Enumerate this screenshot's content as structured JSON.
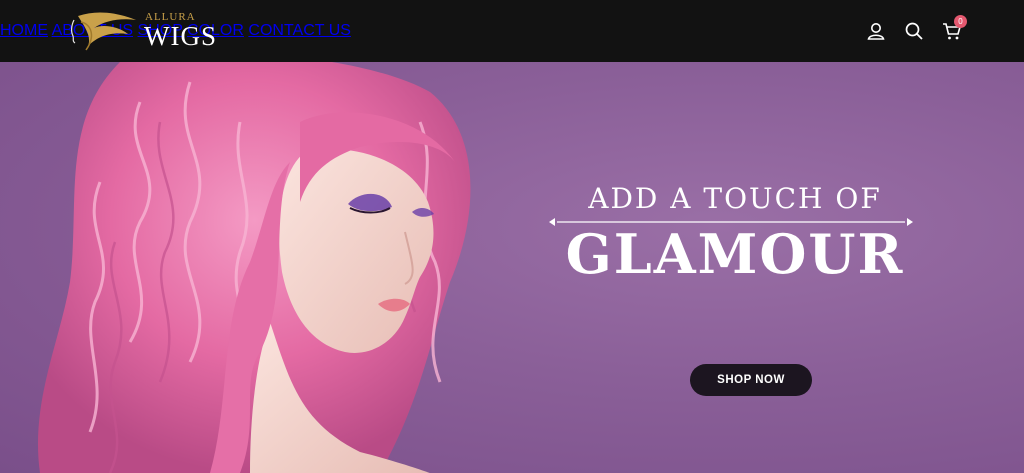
{
  "brand": {
    "top": "ALLURA",
    "main": "WIGS",
    "accent": "#c9a14a"
  },
  "nav": {
    "items": [
      {
        "label": "HOME"
      },
      {
        "label": "ABOUT US"
      },
      {
        "label": "SHOP"
      },
      {
        "label": "COLOR"
      },
      {
        "label": "CONTACT US"
      }
    ]
  },
  "header_icons": {
    "user": "user-icon",
    "search": "search-icon",
    "cart": "cart-icon",
    "cart_count": "0"
  },
  "hero": {
    "tagline": "ADD A TOUCH OF",
    "headline": "GLAMOUR",
    "cta_label": "SHOP NOW",
    "background": "#8a5f98",
    "hair_color": "#e86ea6"
  }
}
